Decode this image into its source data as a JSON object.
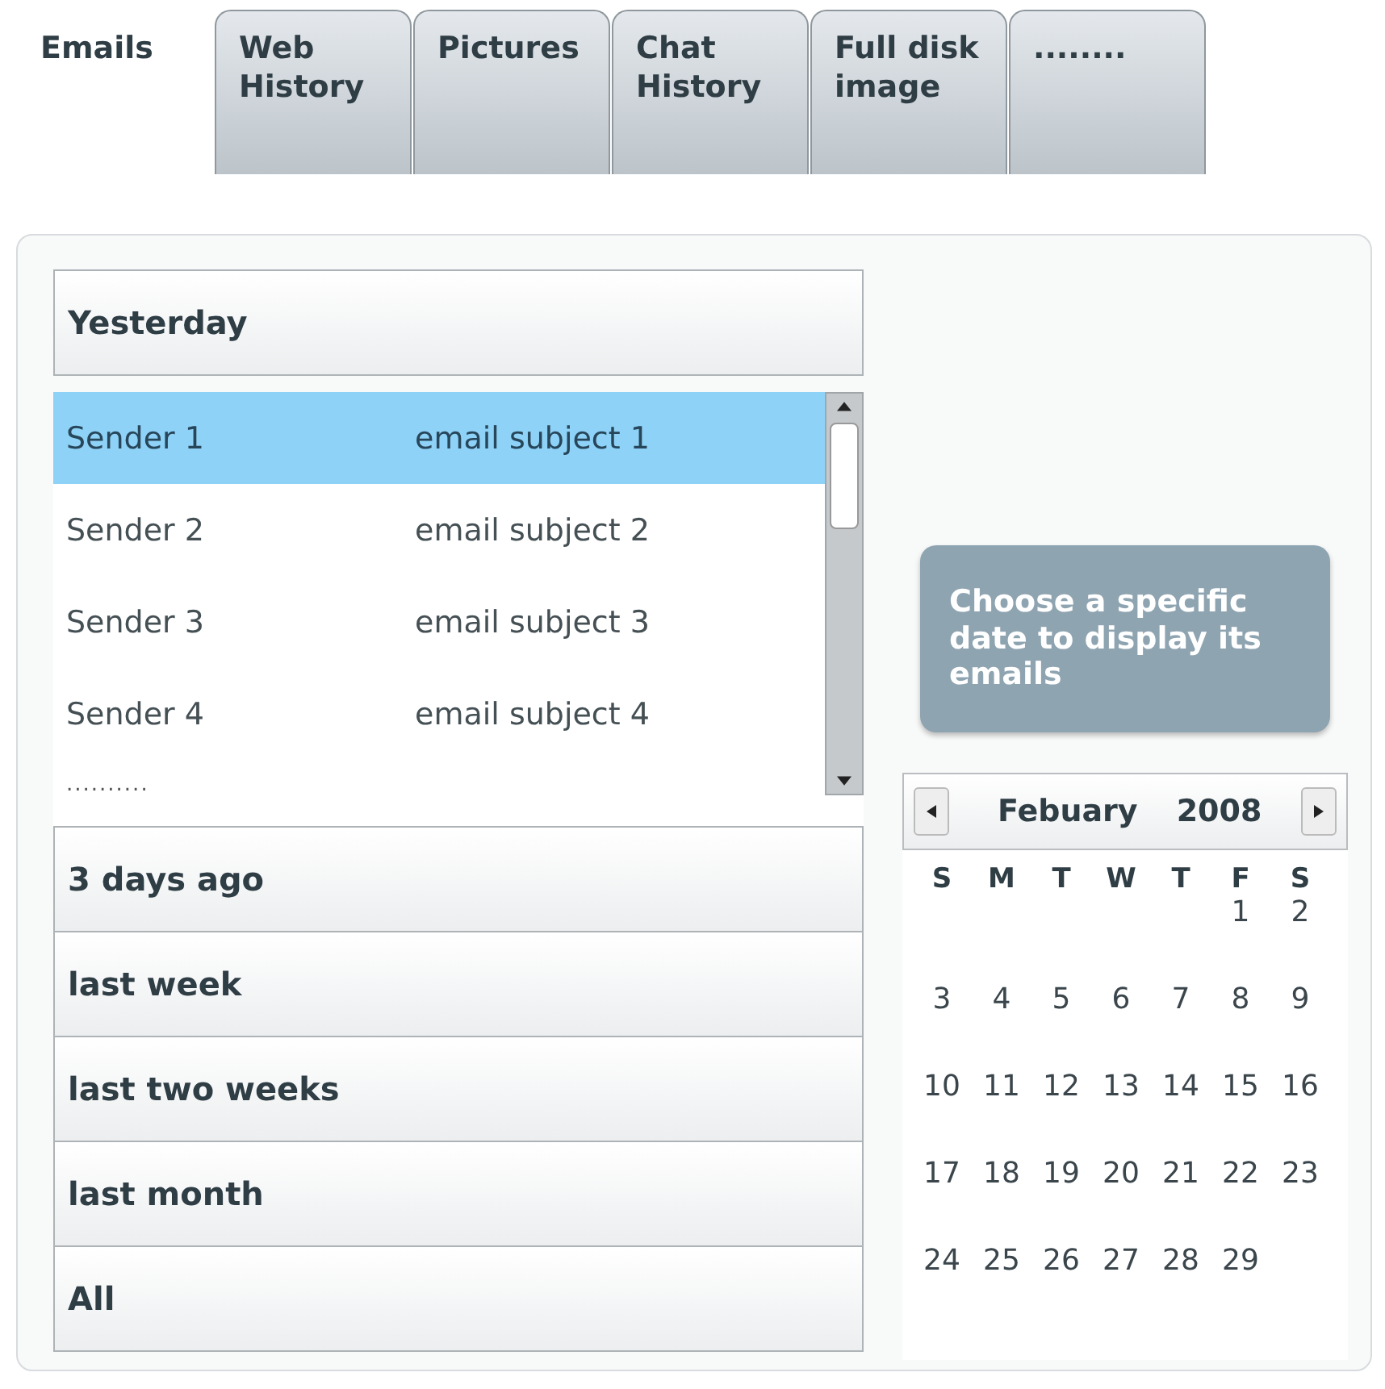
{
  "tabs": [
    {
      "label": "Emails",
      "selected": true
    },
    {
      "label": "Web History",
      "selected": false
    },
    {
      "label": "Pictures",
      "selected": false
    },
    {
      "label": "Chat History",
      "selected": false
    },
    {
      "label": "Full disk image",
      "selected": false
    },
    {
      "label": "........",
      "selected": false
    }
  ],
  "groups": [
    {
      "title": "Yesterday",
      "expanded": true,
      "emails": [
        {
          "sender": "Sender 1",
          "subject": "email subject 1",
          "selected": true
        },
        {
          "sender": "Sender 2",
          "subject": "email subject 2",
          "selected": false
        },
        {
          "sender": "Sender 3",
          "subject": "email subject 3",
          "selected": false
        },
        {
          "sender": "Sender 4",
          "subject": "email subject 4",
          "selected": false
        }
      ],
      "more": ".........."
    },
    {
      "title": "3 days ago",
      "expanded": false
    },
    {
      "title": "last week",
      "expanded": false
    },
    {
      "title": "last two weeks",
      "expanded": false
    },
    {
      "title": "last month",
      "expanded": false
    },
    {
      "title": "All",
      "expanded": false
    }
  ],
  "date_button": {
    "label": "Choose a specific date to display its emails",
    "disabled": true
  },
  "calendar": {
    "month": "Febuary",
    "year": "2008",
    "weekdays": [
      "S",
      "M",
      "T",
      "W",
      "T",
      "F",
      "S"
    ],
    "weeks": [
      {
        "starts_mid_week": true,
        "days": [
          "1",
          "2"
        ]
      },
      {
        "days": [
          "3",
          "4",
          "5",
          "6",
          "7",
          "8",
          "9"
        ]
      },
      {
        "days": [
          "10",
          "11",
          "12",
          "13",
          "14",
          "15",
          "16"
        ]
      },
      {
        "days": [
          "17",
          "18",
          "19",
          "20",
          "21",
          "22",
          "23"
        ]
      },
      {
        "days": [
          "24",
          "25",
          "26",
          "27",
          "28",
          "29"
        ]
      }
    ]
  }
}
